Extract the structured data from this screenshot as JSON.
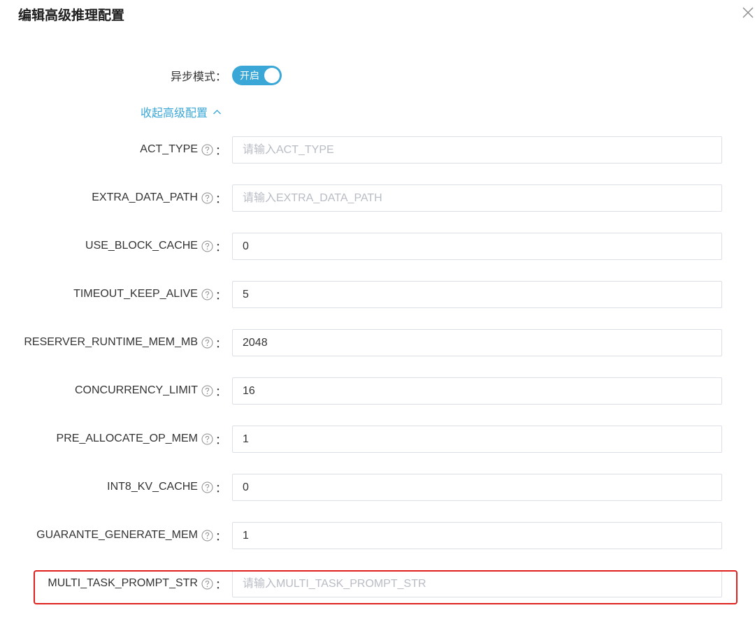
{
  "dialog": {
    "title": "编辑高级推理配置",
    "close_icon": "close-icon"
  },
  "async_mode": {
    "label": "异步模式",
    "colon": "：",
    "toggle_text": "开启",
    "enabled": true,
    "toggle_color": "#3aa7d6"
  },
  "collapse_link": {
    "label": "收起高级配置",
    "icon": "chevron-up-icon",
    "color": "#3aa7d6"
  },
  "fields": [
    {
      "label": "ACT_TYPE",
      "value": "",
      "placeholder": "请输入ACT_TYPE",
      "help_icon": "help-circle-icon"
    },
    {
      "label": "EXTRA_DATA_PATH",
      "value": "",
      "placeholder": "请输入EXTRA_DATA_PATH",
      "help_icon": "help-circle-icon"
    },
    {
      "label": "USE_BLOCK_CACHE",
      "value": "0",
      "placeholder": "",
      "help_icon": "help-circle-icon"
    },
    {
      "label": "TIMEOUT_KEEP_ALIVE",
      "value": "5",
      "placeholder": "",
      "help_icon": "help-circle-icon"
    },
    {
      "label": "RESERVER_RUNTIME_MEM_MB",
      "value": "2048",
      "placeholder": "",
      "help_icon": "help-circle-icon"
    },
    {
      "label": "CONCURRENCY_LIMIT",
      "value": "16",
      "placeholder": "",
      "help_icon": "help-circle-icon"
    },
    {
      "label": "PRE_ALLOCATE_OP_MEM",
      "value": "1",
      "placeholder": "",
      "help_icon": "help-circle-icon"
    },
    {
      "label": "INT8_KV_CACHE",
      "value": "0",
      "placeholder": "",
      "help_icon": "help-circle-icon"
    },
    {
      "label": "GUARANTE_GENERATE_MEM",
      "value": "1",
      "placeholder": "",
      "help_icon": "help-circle-icon"
    },
    {
      "label": "MULTI_TASK_PROMPT_STR",
      "value": "",
      "placeholder": "请输入MULTI_TASK_PROMPT_STR",
      "help_icon": "help-circle-icon"
    }
  ],
  "field_colon": "：",
  "highlight": {
    "color": "#e0201d",
    "target": "MULTI_TASK_PROMPT_STR"
  }
}
